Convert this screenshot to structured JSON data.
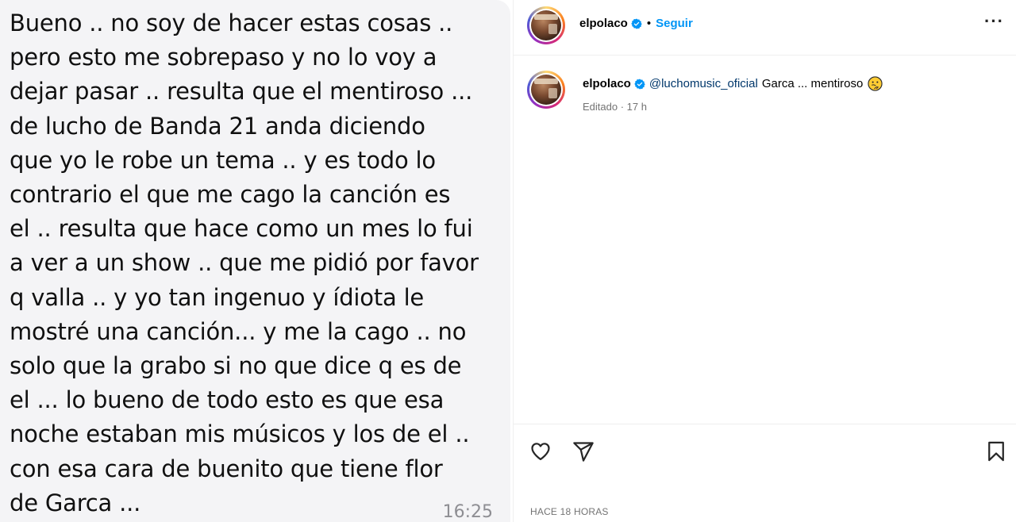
{
  "chat": {
    "message_lines": [
      "Bueno .. no soy de hacer estas cosas ..",
      "pero esto me sobrepaso y no lo voy a",
      "dejar pasar .. resulta que el mentiroso ...",
      "de lucho de Banda 21 anda diciendo",
      "que yo le robe un tema .. y es todo lo",
      "contrario el que me cago la canción es",
      "el .. resulta que hace como un mes lo fui",
      "a ver a un show .. que me pidió por favor",
      "q valla .. y yo tan ingenuo y ídiota le",
      "mostré una canción... y me la cago .. no",
      "solo que la grabo si no que dice q es de",
      "el ... lo bueno de todo esto es que esa",
      "noche estaban mis músicos y los de el ..",
      "con esa cara de buenito que tiene flor",
      "de Garca ..."
    ],
    "time": "16:25"
  },
  "post": {
    "header": {
      "username": "elpolaco",
      "follow_label": "Seguir",
      "separator": "•",
      "more_label": "···"
    },
    "comment": {
      "username": "elpolaco",
      "mention": "@luchomusic_oficial",
      "text": "Garca ... mentiroso",
      "meta": "Editado · 17 h"
    },
    "timestamp": "HACE 18 HORAS"
  },
  "colors": {
    "link_blue": "#0095f6",
    "mention_blue": "#00376b",
    "verified_blue": "#0095f6",
    "muted_gray": "#737373",
    "chat_bubble_bg": "#f4f4f6"
  },
  "icons": {
    "verified": "verified-badge-icon",
    "like": "heart-icon",
    "share": "paper-plane-icon",
    "save": "bookmark-icon",
    "emoji": "thinking-face-emoji-icon"
  }
}
